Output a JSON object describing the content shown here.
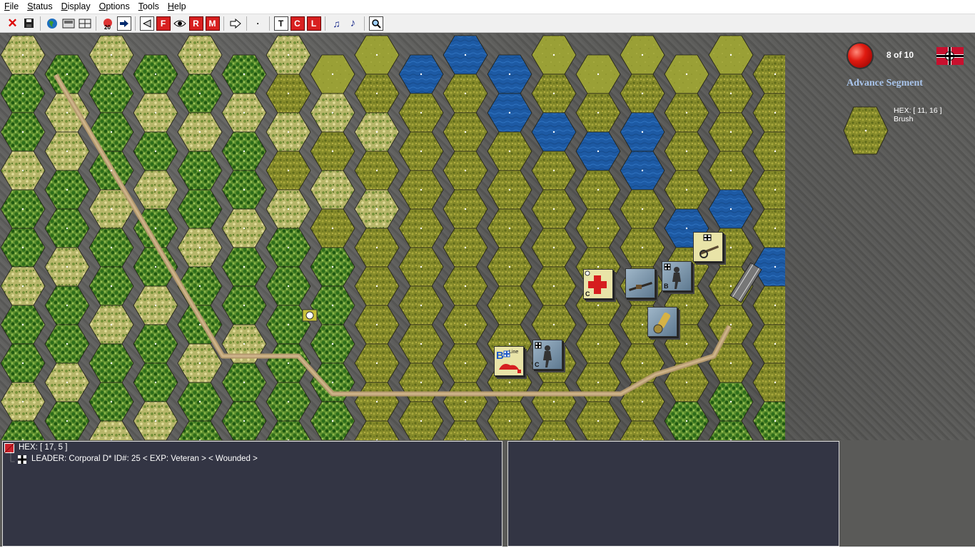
{
  "menu": [
    {
      "ul": "F",
      "rest": "ile"
    },
    {
      "ul": "S",
      "rest": "tatus"
    },
    {
      "ul": "D",
      "rest": "isplay"
    },
    {
      "ul": "O",
      "rest": "ptions"
    },
    {
      "ul": "T",
      "rest": "ools"
    },
    {
      "ul": "H",
      "rest": "elp"
    }
  ],
  "toolbar": {
    "text_buttons": {
      "f": "F",
      "r": "R",
      "m": "M",
      "t": "T",
      "c": "C",
      "l": "L",
      "dot": "·"
    },
    "icons": [
      "close-icon",
      "save-icon",
      "globe-icon",
      "map-icon",
      "grid-icon",
      "turn-20-icon",
      "next-arrow-icon",
      "back-triangle-icon",
      "f-icon",
      "eye-icon",
      "r-icon",
      "m-icon",
      "forward-arrow-icon",
      "dot-icon",
      "t-icon",
      "c-icon",
      "l-icon",
      "fx-music-icon",
      "music-icon",
      "magnify-icon"
    ]
  },
  "turn": {
    "label": "8 of 10"
  },
  "phase": {
    "label": "Advance Segment"
  },
  "hex_info": {
    "coord": "HEX: [ 11, 16 ]",
    "terrain": "Brush"
  },
  "selected": {
    "hex": "HEX: [ 17, 5 ]",
    "leader": "LEADER: Corporal D*   ID#: 25 < EXP: Veteran >  < Wounded >"
  },
  "counters": [
    {
      "name": "medic-counter",
      "letter": "C",
      "style": "tan"
    },
    {
      "name": "mg-counter",
      "letter": "",
      "style": "inf"
    },
    {
      "name": "infantry-squad-b-counter",
      "letter": "B",
      "style": "inf"
    },
    {
      "name": "artillery-counter",
      "letter": "",
      "style": "tan"
    },
    {
      "name": "mortar-counter",
      "letter": "",
      "style": "inf"
    },
    {
      "name": "line-b-counter",
      "letter": "B",
      "style": "tan"
    },
    {
      "name": "infantry-squad-c-counter",
      "letter": "C",
      "style": "inf"
    }
  ],
  "colors": {
    "clear": "#9aa036",
    "brush": "#8a8e2c",
    "forest": "#3d7a22",
    "light": "#b9b969",
    "water": "#1d5aa4",
    "road": "#b59a6e",
    "panel": "#333544",
    "phase_title": "#a9c5ec"
  }
}
